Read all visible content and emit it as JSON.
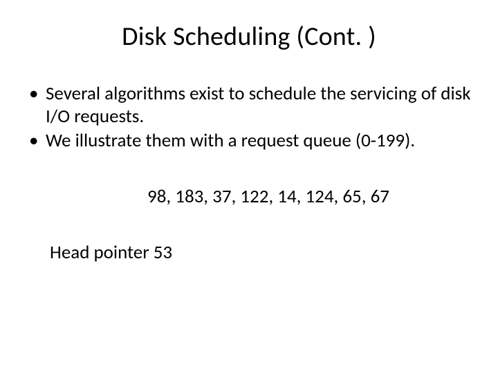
{
  "title": "Disk Scheduling (Cont. )",
  "bullets": {
    "b0": "Several algorithms exist to schedule the servicing of disk I/O requests.",
    "b1": "We illustrate them with a request queue (0-199)."
  },
  "queue_text": "98, 183, 37, 122, 14, 124, 65, 67",
  "head_pointer_text": "Head pointer 53"
}
